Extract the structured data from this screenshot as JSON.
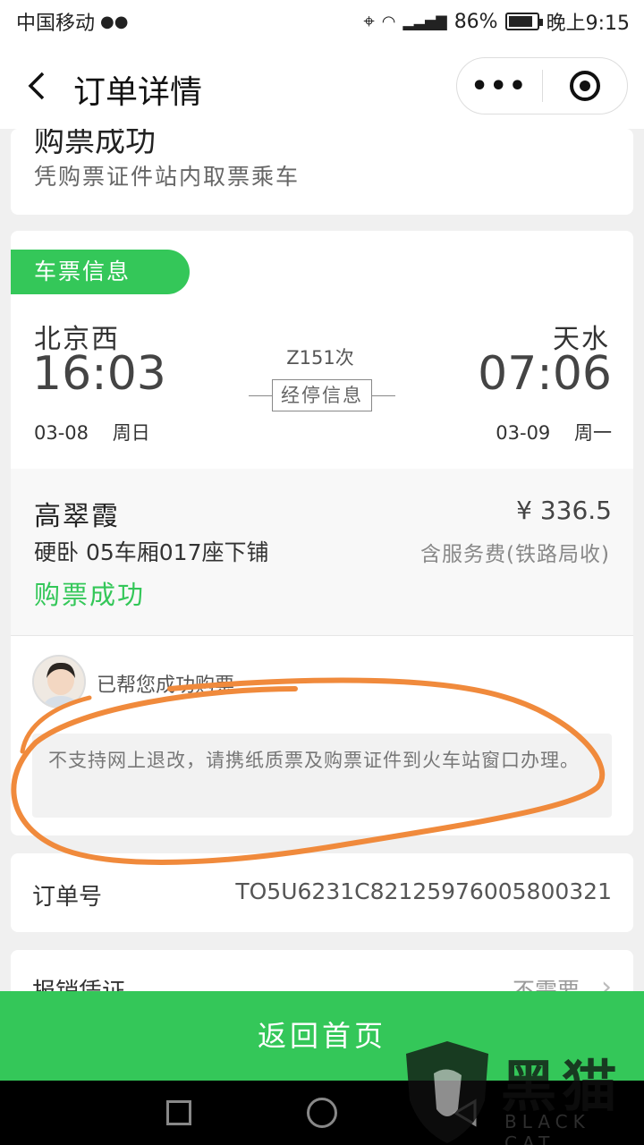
{
  "status_bar": {
    "carrier": "中国移动",
    "battery": "86%",
    "battery_level": 0.86,
    "time": "晚上9:15"
  },
  "nav": {
    "title": "订单详情",
    "more": "•••"
  },
  "order_status": {
    "title": "购票成功",
    "subtitle": "凭购票证件站内取票乘车"
  },
  "ticket": {
    "tag": "车票信息",
    "from_station": "北京西",
    "from_time": "16:03",
    "from_date": "03-08",
    "from_weekday": "周日",
    "train_no": "Z151次",
    "stops_label": "经停信息",
    "to_station": "天水",
    "to_time": "07:06",
    "to_date": "03-09",
    "to_weekday": "周一"
  },
  "passenger": {
    "name": "高翠霞",
    "price": "¥ 336.5",
    "seat": "硬卧 05车厢017座下铺",
    "fee_note": "含服务费(铁路局收)",
    "status": "购票成功"
  },
  "message": {
    "text": "已帮您成功购票",
    "notice": "不支持网上退改，请携纸质票及购票证件到火车站窗口办理。"
  },
  "order": {
    "label": "订单号",
    "number": "TO5U6231C82125976005800321"
  },
  "invoice": {
    "label": "报销凭证",
    "value": "不需要"
  },
  "bottom": {
    "home_button": "返回首页"
  },
  "watermark": {
    "text": "黑猫",
    "sub": "BLACK CAT"
  },
  "colors": {
    "accent": "#34c759",
    "annotation": "#f08a3c"
  }
}
